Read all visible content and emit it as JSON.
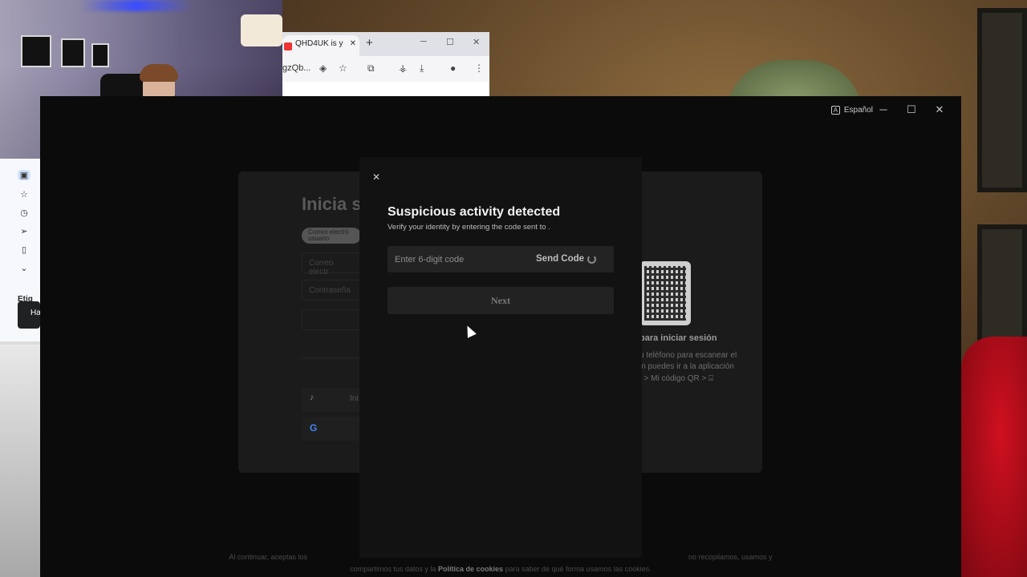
{
  "browser": {
    "tab_title": "QHD4UK is y",
    "tab_close": "✕",
    "new_tab": "+",
    "url_fragment": "gzQb...",
    "minimize": "─",
    "maximize": "☐",
    "close": "✕"
  },
  "gmail": {
    "label_partial": "Etiq",
    "tooltip_partial": "Ha"
  },
  "app": {
    "language": "Español",
    "minimize": "─",
    "maximize": "☐",
    "close": "✕"
  },
  "login": {
    "title_partial": "Inicia se",
    "pill_text": "Correo electró usuario",
    "email_placeholder": "Correo electr",
    "password_placeholder": "Contraseña",
    "tiktok_btn_partial": "Ini",
    "qr_title": "para iniciar sesión",
    "qr_lines": [
      "u teléfono para escanear el",
      "in puedes ir a la aplicación",
      ": > Mi código QR > ⌸"
    ]
  },
  "footer": {
    "line1_left": "Al continuar, aceptas los",
    "line1_right": "no recopilamos, usamos y",
    "line2_before": "compartimos tus datos y la",
    "line2_bold": "Política de cookies",
    "line2_after": "para saber de qué forma usamos las cookies."
  },
  "modal": {
    "close": "✕",
    "title": "Suspicious activity detected",
    "subtitle": "Verify your identity by entering the code sent to .",
    "code_placeholder": "Enter 6-digit code",
    "send_code": "Send Code",
    "next": "Next"
  }
}
